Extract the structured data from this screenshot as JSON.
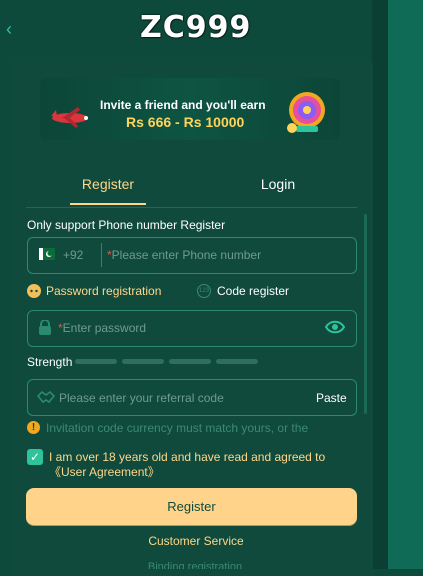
{
  "header": {
    "back_icon": "chevron-left-icon",
    "logo_text": "ZC999"
  },
  "banner": {
    "title": "Invite a friend and you'll earn",
    "amount": "Rs 666 - Rs 10000"
  },
  "tabs": [
    {
      "label": "Register",
      "active": true
    },
    {
      "label": "Login",
      "active": false
    }
  ],
  "form": {
    "support_note": "Only support Phone number Register",
    "phone": {
      "country_code": "+92",
      "placeholder": "*Please enter Phone number",
      "required_mark": "*",
      "placeholder_text": "Please enter Phone number"
    },
    "methods": [
      {
        "label": "Password registration",
        "selected": true
      },
      {
        "label": "Code register",
        "selected": false
      }
    ],
    "password": {
      "required_mark": "*",
      "placeholder_text": "Enter password"
    },
    "strength": {
      "label": "Strength",
      "level": 0,
      "segments": 4
    },
    "referral": {
      "placeholder": "Please enter your referral code",
      "paste_label": "Paste"
    },
    "notice": "Invitation code currency must match yours, or the",
    "agreement": {
      "checked": true,
      "text": "I am over 18 years old and have read and agreed to",
      "link": "《User Agreement》"
    },
    "register_button": "Register",
    "customer_service": "Customer Service",
    "binding_registration": "Binding registration"
  },
  "colors": {
    "background": "#0d4a3c",
    "card": "#0f4a3d",
    "accent_gold": "#ffd78a",
    "accent_green": "#2fc39b",
    "field_border": "#2b8a70",
    "required_red": "#e0584c"
  }
}
